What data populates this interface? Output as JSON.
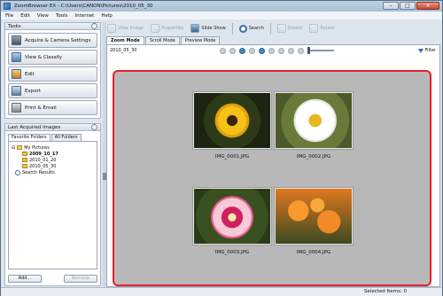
{
  "window": {
    "title": "ZoomBrowser EX - C:\\Users\\CANON\\Pictures\\2010_05_30"
  },
  "menu": [
    "File",
    "Edit",
    "View",
    "Tools",
    "Internet",
    "Help"
  ],
  "toolbar": {
    "view_image": "View Image",
    "properties": "Properties",
    "slide_show": "Slide Show",
    "search": "Search",
    "delete": "Delete",
    "rotate": "Rotate"
  },
  "tasks": {
    "title": "Tasks",
    "items": [
      "Acquire & Camera Settings",
      "View & Classify",
      "Edit",
      "Export",
      "Print & Email"
    ]
  },
  "last_acquired": {
    "title": "Last Acquired Images",
    "tabs": [
      "Favorite Folders",
      "All Folders"
    ],
    "tree": {
      "root": "My Pictures",
      "folders": [
        "2009_10_17",
        "2010_01_20",
        "2010_05_30"
      ],
      "search": "Search Results"
    },
    "add_label": "Add...",
    "remove_label": "Remove"
  },
  "view_tabs": [
    "Zoom Mode",
    "Scroll Mode",
    "Preview Mode"
  ],
  "main": {
    "folder_date": "2010_05_30",
    "filter_label": "Filter"
  },
  "images": [
    "IMG_0001.JPG",
    "IMG_0002.JPG",
    "IMG_0003.JPG",
    "IMG_0004.JPG"
  ],
  "status": {
    "selected_items": "Selected Items: 0"
  },
  "colors": {
    "highlight_border": "#e8202a",
    "gallery_bg": "#b8b8b8"
  }
}
